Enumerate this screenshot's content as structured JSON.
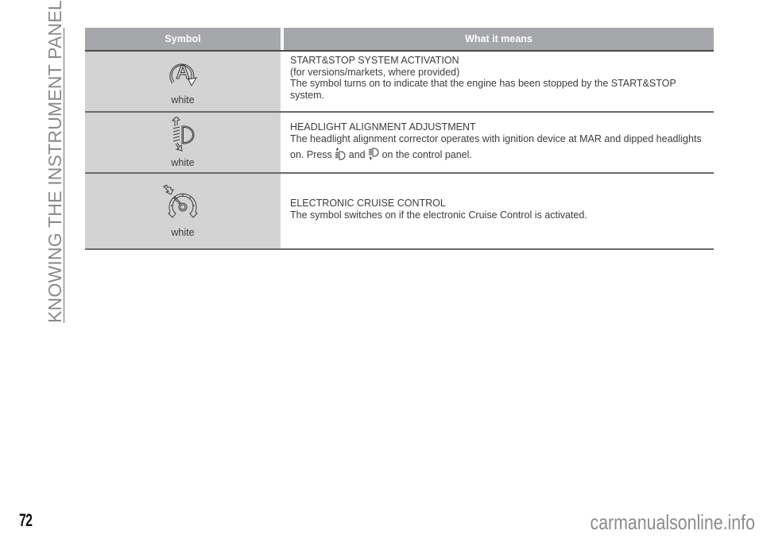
{
  "sidebar": {
    "section_title": "KNOWING THE INSTRUMENT PANEL"
  },
  "table": {
    "headers": {
      "symbol": "Symbol",
      "meaning": "What it means"
    },
    "rows": [
      {
        "icon": "start-stop-icon",
        "color_label": "white",
        "title": "START&STOP SYSTEM ACTIVATION",
        "note": "(for versions/markets, where provided)",
        "description": "The symbol turns on to indicate that the engine has been stopped by the START&STOP system."
      },
      {
        "icon": "headlight-alignment-icon",
        "color_label": "white",
        "title": "HEADLIGHT ALIGNMENT ADJUSTMENT",
        "description": "The headlight alignment corrector operates with ignition device at MAR and dipped headlights",
        "press_prefix": "on. Press",
        "press_and": "and",
        "press_suffix": "on the control panel."
      },
      {
        "icon": "cruise-control-icon",
        "color_label": "white",
        "title": "ELECTRONIC CRUISE CONTROL",
        "description": "The symbol switches on if the electronic Cruise Control is activated."
      }
    ]
  },
  "footer": {
    "page_number": "72",
    "watermark": "carmanualsonline.info"
  }
}
